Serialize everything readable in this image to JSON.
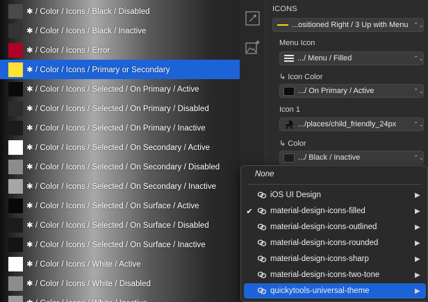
{
  "swatches": [
    {
      "label": "✱ / Color / Icons / Black / Disabled",
      "color": "#4a4a4a"
    },
    {
      "label": "✱ / Color / Icons / Black / Inactive",
      "color": "#333333"
    },
    {
      "label": "✱ / Color / Icons / Error",
      "color": "#b0002a"
    },
    {
      "label": "✱ / Color / Icons / Primary or Secondary",
      "color": "#ffe234",
      "selected": true
    },
    {
      "label": "✱ / Color / Icons / Selected / On Primary / Active",
      "color": "#0b0b0b"
    },
    {
      "label": "✱ / Color / Icons / Selected / On Primary / Disabled",
      "color": "#2c2c2c"
    },
    {
      "label": "✱ / Color / Icons / Selected / On Primary / Inactive",
      "color": "#1c1c1c"
    },
    {
      "label": "✱ / Color / Icons / Selected / On Secondary / Active",
      "color": "#ffffff"
    },
    {
      "label": "✱ / Color / Icons / Selected / On Secondary / Disabled",
      "color": "#8c8c8c"
    },
    {
      "label": "✱ / Color / Icons / Selected / On Secondary / Inactive",
      "color": "#a6a6a6"
    },
    {
      "label": "✱ / Color / Icons / Selected / On Surface / Active",
      "color": "#080808"
    },
    {
      "label": "✱ / Color / Icons / Selected / On Surface / Disabled",
      "color": "#1c1c1c"
    },
    {
      "label": "✱ / Color / Icons / Selected / On Surface / Inactive",
      "color": "#141414"
    },
    {
      "label": "✱ / Color / Icons / White / Active",
      "color": "#ffffff"
    },
    {
      "label": "✱ / Color / Icons / White / Disabled",
      "color": "#8c8c8c"
    },
    {
      "label": "✱ / Color / Icons / White / Inactive",
      "color": "#9a9a9a"
    }
  ],
  "inspector": {
    "section_title": "ICONS",
    "layout_value": "...ositioned Right / 3 Up with Menu",
    "menu_icon_label": "Menu Icon",
    "menu_icon_value": ".../ Menu / Filled",
    "icon_color_label": "↳ Icon Color",
    "icon_color_value": ".../ On Primary / Active",
    "icon1_label": "Icon 1",
    "icon1_value": ".../places/child_friendly_24px",
    "color_label": "↳ Color",
    "color_value": ".../ Black / Inactive"
  },
  "menu": {
    "none_label": "None",
    "items": [
      {
        "label": "iOS UI Design",
        "checked": false,
        "active": false
      },
      {
        "label": "material-design-icons-filled",
        "checked": true,
        "active": false
      },
      {
        "label": "material-design-icons-outlined",
        "checked": false,
        "active": false
      },
      {
        "label": "material-design-icons-rounded",
        "checked": false,
        "active": false
      },
      {
        "label": "material-design-icons-sharp",
        "checked": false,
        "active": false
      },
      {
        "label": "material-design-icons-two-tone",
        "checked": false,
        "active": false
      },
      {
        "label": "quickytools-universal-theme",
        "checked": false,
        "active": true
      }
    ],
    "check_glyph": "✔",
    "submenu_glyph": "▶"
  },
  "colors": {
    "accent": "#1d63d8",
    "layout_line": "#ffd60a",
    "icon_color_swatch": "#0b0b0b",
    "color_swatch": "#1e1e1e"
  }
}
